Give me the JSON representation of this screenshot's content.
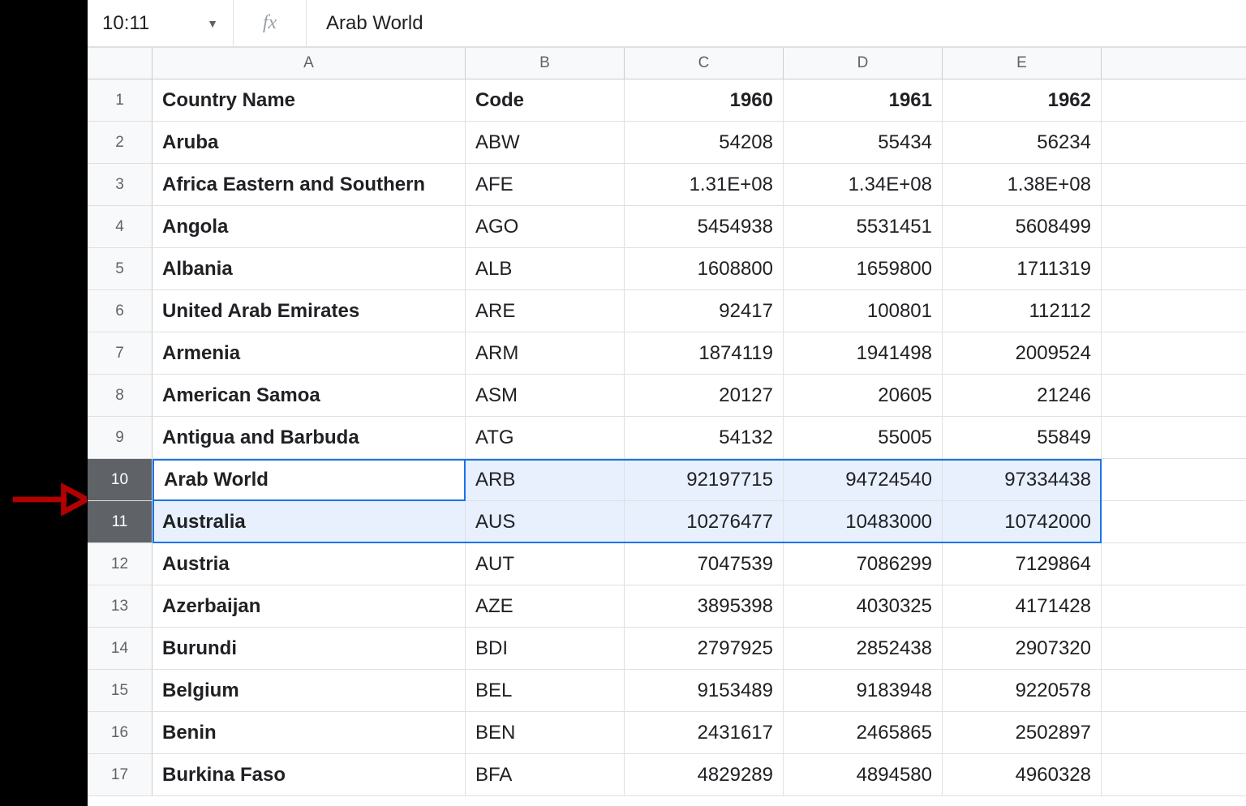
{
  "namebox": {
    "value": "10:11"
  },
  "fx_label": "fx",
  "formula": "Arab World",
  "columns": [
    "A",
    "B",
    "C",
    "D",
    "E"
  ],
  "headers": {
    "name": "Country Name",
    "code": "Code",
    "y1960": "1960",
    "y1961": "1961",
    "y1962": "1962"
  },
  "selected_rows": [
    10,
    11
  ],
  "active_cell_text": "Arab World",
  "rows": [
    {
      "n": 1,
      "name": "Country Name",
      "code": "Code",
      "c": "1960",
      "d": "1961",
      "e": "1962",
      "is_header": true
    },
    {
      "n": 2,
      "name": "Aruba",
      "code": "ABW",
      "c": "54208",
      "d": "55434",
      "e": "56234"
    },
    {
      "n": 3,
      "name": "Africa Eastern and Southern",
      "code": "AFE",
      "c": "1.31E+08",
      "d": "1.34E+08",
      "e": "1.38E+08"
    },
    {
      "n": 4,
      "name": "Angola",
      "code": "AGO",
      "c": "5454938",
      "d": "5531451",
      "e": "5608499"
    },
    {
      "n": 5,
      "name": "Albania",
      "code": "ALB",
      "c": "1608800",
      "d": "1659800",
      "e": "1711319"
    },
    {
      "n": 6,
      "name": "United Arab Emirates",
      "code": "ARE",
      "c": "92417",
      "d": "100801",
      "e": "112112"
    },
    {
      "n": 7,
      "name": "Armenia",
      "code": "ARM",
      "c": "1874119",
      "d": "1941498",
      "e": "2009524"
    },
    {
      "n": 8,
      "name": "American Samoa",
      "code": "ASM",
      "c": "20127",
      "d": "20605",
      "e": "21246"
    },
    {
      "n": 9,
      "name": "Antigua and Barbuda",
      "code": "ATG",
      "c": "54132",
      "d": "55005",
      "e": "55849"
    },
    {
      "n": 10,
      "name": "Arab World",
      "code": "ARB",
      "c": "92197715",
      "d": "94724540",
      "e": "97334438"
    },
    {
      "n": 11,
      "name": "Australia",
      "code": "AUS",
      "c": "10276477",
      "d": "10483000",
      "e": "10742000"
    },
    {
      "n": 12,
      "name": "Austria",
      "code": "AUT",
      "c": "7047539",
      "d": "7086299",
      "e": "7129864"
    },
    {
      "n": 13,
      "name": "Azerbaijan",
      "code": "AZE",
      "c": "3895398",
      "d": "4030325",
      "e": "4171428"
    },
    {
      "n": 14,
      "name": "Burundi",
      "code": "BDI",
      "c": "2797925",
      "d": "2852438",
      "e": "2907320"
    },
    {
      "n": 15,
      "name": "Belgium",
      "code": "BEL",
      "c": "9153489",
      "d": "9183948",
      "e": "9220578"
    },
    {
      "n": 16,
      "name": "Benin",
      "code": "BEN",
      "c": "2431617",
      "d": "2465865",
      "e": "2502897"
    },
    {
      "n": 17,
      "name": "Burkina Faso",
      "code": "BFA",
      "c": "4829289",
      "d": "4894580",
      "e": "4960328"
    }
  ]
}
